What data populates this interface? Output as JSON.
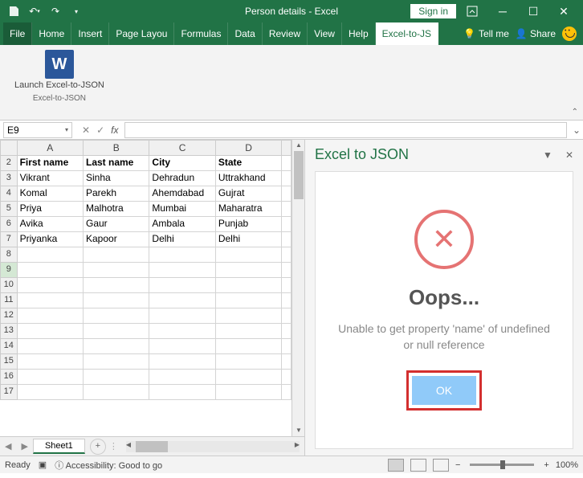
{
  "titlebar": {
    "title": "Person details - Excel",
    "signin": "Sign in"
  },
  "ribbon": {
    "tabs": [
      "File",
      "Home",
      "Insert",
      "Page Layou",
      "Formulas",
      "Data",
      "Review",
      "View",
      "Help",
      "Excel-to-JS"
    ],
    "active_tab": "Excel-to-JS",
    "tellme": "Tell me",
    "share": "Share",
    "launch_label": "Launch Excel-to-JSON",
    "group_name": "Excel-to-JSON",
    "icon_letter": "W"
  },
  "namebox": {
    "value": "E9",
    "fx": "fx"
  },
  "grid": {
    "columns": [
      "A",
      "B",
      "C",
      "D"
    ],
    "row_start": 2,
    "active_row": 9,
    "headers": [
      "First name",
      "Last name",
      "City",
      "State"
    ],
    "rows": [
      [
        "Vikrant",
        "Sinha",
        "Dehradun",
        "Uttrakhand"
      ],
      [
        "Komal",
        "Parekh",
        "Ahemdabad",
        "Gujrat"
      ],
      [
        "Priya",
        "Malhotra",
        "Mumbai",
        "Maharatra"
      ],
      [
        "Avika",
        "Gaur",
        "Ambala",
        "Punjab"
      ],
      [
        "Priyanka",
        "Kapoor",
        "Delhi",
        "Delhi"
      ]
    ]
  },
  "sheet": {
    "name": "Sheet1"
  },
  "taskpane": {
    "title": "Excel to JSON",
    "heading": "Oops...",
    "message": "Unable to get property 'name' of undefined or null reference",
    "ok": "OK"
  },
  "statusbar": {
    "ready": "Ready",
    "accessibility": "Accessibility: Good to go",
    "zoom": "100%"
  }
}
